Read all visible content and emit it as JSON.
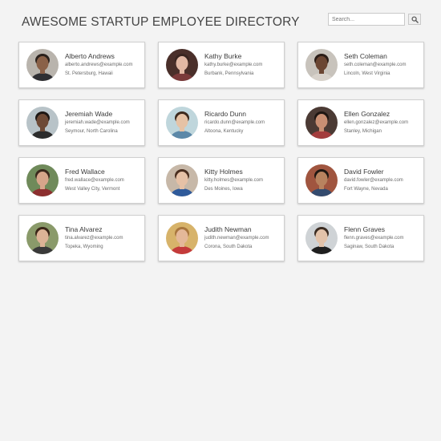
{
  "header": {
    "title": "AWESOME STARTUP EMPLOYEE DIRECTORY",
    "search_placeholder": "Search...",
    "search_value": ""
  },
  "employees": [
    {
      "name": "Alberto Andrews",
      "email": "alberto.andrews@example.com",
      "location": "St. Petersburg, Hawaii",
      "avatar": {
        "bg": "#b9b4ad",
        "skin": "#8a6148",
        "hair": "#2a211c",
        "shirt": "#2f2f33"
      }
    },
    {
      "name": "Kathy Burke",
      "email": "kathy.burke@example.com",
      "location": "Burbank, Pennsylvania",
      "avatar": {
        "bg": "#4a2f2a",
        "skin": "#e2b8a4",
        "hair": "#3a2520",
        "shirt": "#7b3a3a"
      }
    },
    {
      "name": "Seth Coleman",
      "email": "seth.coleman@example.com",
      "location": "Lincoln, West Virginia",
      "avatar": {
        "bg": "#c8c3bc",
        "skin": "#6b4633",
        "hair": "#2b1d17",
        "shirt": "#d8d2cb"
      }
    },
    {
      "name": "Jeremiah Wade",
      "email": "jeremiah.wade@example.com",
      "location": "Seymour, North Carolina",
      "avatar": {
        "bg": "#b8c3c8",
        "skin": "#6e4a36",
        "hair": "#1d1714",
        "shirt": "#2c2c2c"
      }
    },
    {
      "name": "Ricardo Dunn",
      "email": "ricardo.dunn@example.com",
      "location": "Altoona, Kentucky",
      "avatar": {
        "bg": "#bfd6dc",
        "skin": "#e6c2a5",
        "hair": "#3d2a1e",
        "shirt": "#5c88a8"
      }
    },
    {
      "name": "Ellen Gonzalez",
      "email": "ellen.gonzalez@example.com",
      "location": "Stanley, Michigan",
      "avatar": {
        "bg": "#4b3a34",
        "skin": "#c98f73",
        "hair": "#1f1612",
        "shirt": "#a33d3d"
      }
    },
    {
      "name": "Fred Wallace",
      "email": "fred.wallace@example.com",
      "location": "West Valley City, Vermont",
      "avatar": {
        "bg": "#6f8a5a",
        "skin": "#d6a58a",
        "hair": "#3a281c",
        "shirt": "#8c2f2f"
      }
    },
    {
      "name": "Kitty Holmes",
      "email": "kitty.holmes@example.com",
      "location": "Des Moines, Iowa",
      "avatar": {
        "bg": "#c7b8a8",
        "skin": "#e6c1a6",
        "hair": "#4a2e1f",
        "shirt": "#2f5a9a"
      }
    },
    {
      "name": "David Fowler",
      "email": "david.fowler@example.com",
      "location": "Fort Wayne, Nevada",
      "avatar": {
        "bg": "#a0553f",
        "skin": "#b8835f",
        "hair": "#1f1712",
        "shirt": "#334b6e"
      }
    },
    {
      "name": "Tina Alvarez",
      "email": "tina.alvarez@example.com",
      "location": "Topeka, Wyoming",
      "avatar": {
        "bg": "#8a9a6a",
        "skin": "#dcb396",
        "hair": "#3a2618",
        "shirt": "#3a3a3a"
      }
    },
    {
      "name": "Judith Newman",
      "email": "judith.newman@example.com",
      "location": "Corona, South Dakota",
      "avatar": {
        "bg": "#d7b36a",
        "skin": "#e4b899",
        "hair": "#a8763e",
        "shirt": "#c43b3b"
      }
    },
    {
      "name": "Flenn Graves",
      "email": "flenn.graves@example.com",
      "location": "Saginaw, South Dakota",
      "avatar": {
        "bg": "#cfd3d6",
        "skin": "#e3c3aa",
        "hair": "#3b2c22",
        "shirt": "#1f1f1f"
      }
    }
  ]
}
